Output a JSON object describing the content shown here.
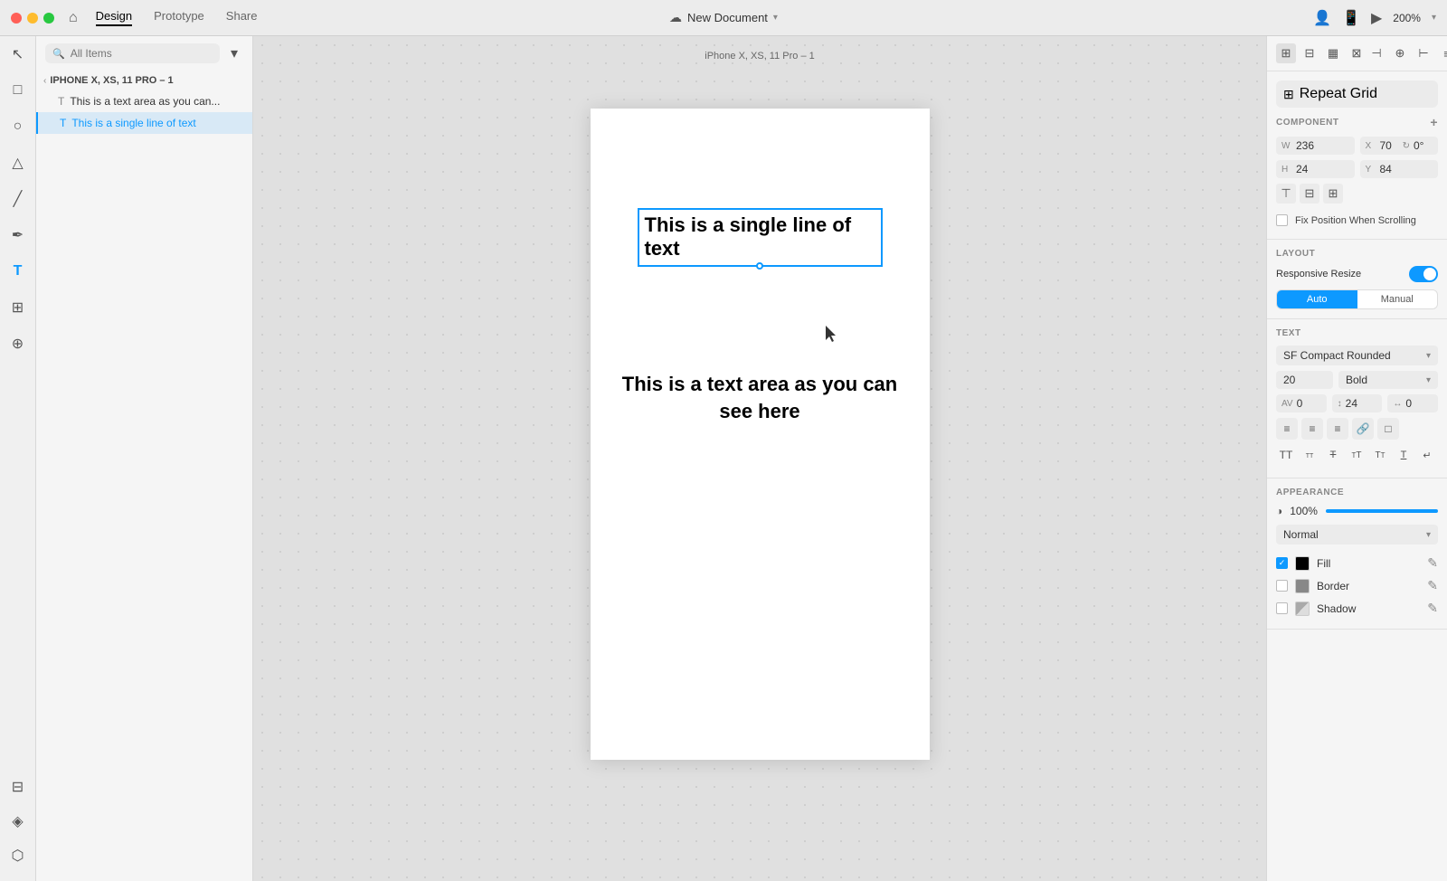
{
  "titlebar": {
    "title": "New Document",
    "zoom": "200%",
    "tabs": [
      {
        "label": "Design",
        "active": true
      },
      {
        "label": "Prototype",
        "active": false
      },
      {
        "label": "Share",
        "active": false
      }
    ]
  },
  "layers": {
    "search_placeholder": "All Items",
    "group_label": "IPHONE X, XS, 11 PRO – 1",
    "items": [
      {
        "label": "This is a text area as you can...",
        "active": false
      },
      {
        "label": "This is a single line of text",
        "active": true
      }
    ]
  },
  "canvas": {
    "artboard_label": "iPhone X, XS, 11 Pro – 1",
    "text_selected": "This is a single line of text",
    "text_area": "This is a text area as you can see here"
  },
  "right_panel": {
    "repeat_grid_label": "Repeat Grid",
    "component_label": "COMPONENT",
    "w_label": "W",
    "w_value": "236",
    "x_label": "X",
    "x_value": "70",
    "rotate_value": "0°",
    "h_label": "H",
    "h_value": "24",
    "y_label": "Y",
    "y_value": "84",
    "fix_position_label": "Fix Position When Scrolling",
    "layout_label": "LAYOUT",
    "responsive_resize_label": "Responsive Resize",
    "auto_label": "Auto",
    "manual_label": "Manual",
    "text_label": "TEXT",
    "font_name": "SF Compact Rounded",
    "font_size": "20",
    "font_weight": "Bold",
    "av_value": "0",
    "line_height": "24",
    "letter_spacing": "0",
    "appearance_label": "APPEARANCE",
    "opacity_value": "100%",
    "blend_mode": "Normal",
    "fill_label": "Fill",
    "border_label": "Border",
    "shadow_label": "Shadow"
  }
}
